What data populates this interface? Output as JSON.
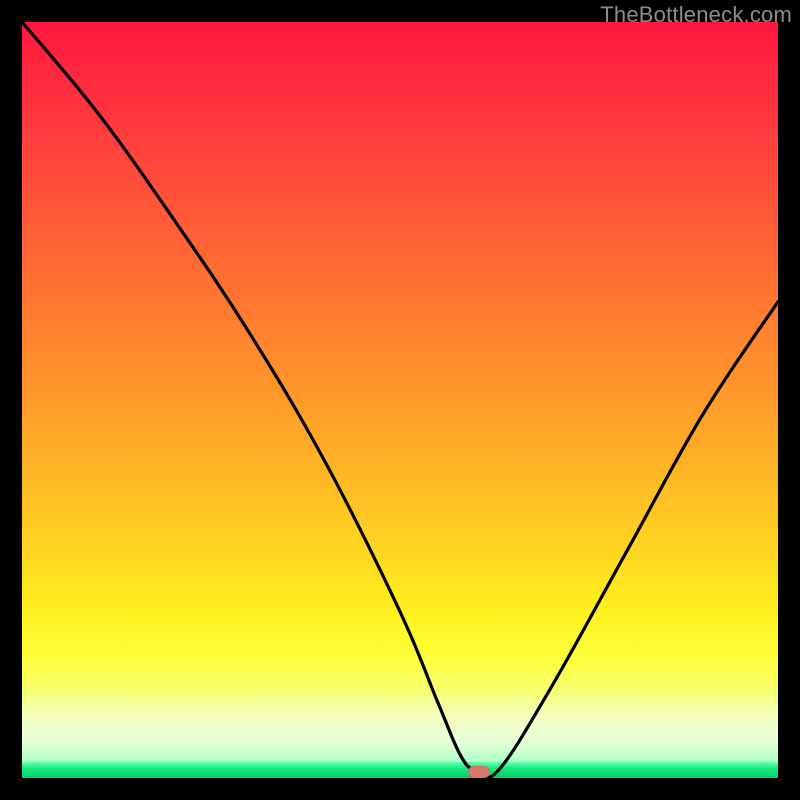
{
  "watermark": "TheBottleneck.com",
  "chart_data": {
    "type": "line",
    "title": "",
    "xlabel": "",
    "ylabel": "",
    "xlim": [
      0,
      100
    ],
    "ylim": [
      0,
      100
    ],
    "grid": false,
    "legend": false,
    "series": [
      {
        "name": "bottleneck-curve",
        "x": [
          0,
          10,
          20,
          30,
          40,
          50,
          55,
          58,
          60,
          63,
          70,
          80,
          90,
          100
        ],
        "values": [
          100,
          88,
          74,
          59,
          42,
          22,
          10,
          3,
          1,
          1,
          12,
          30,
          48,
          63
        ]
      }
    ],
    "annotations": [
      {
        "name": "optimal-marker",
        "x": 60.5,
        "y": 0.8,
        "shape": "pill",
        "color": "#d87a6a"
      }
    ],
    "background_gradient": {
      "top": "#ff163e",
      "mid": "#ffd11f",
      "bottom": "#00d26a"
    }
  }
}
